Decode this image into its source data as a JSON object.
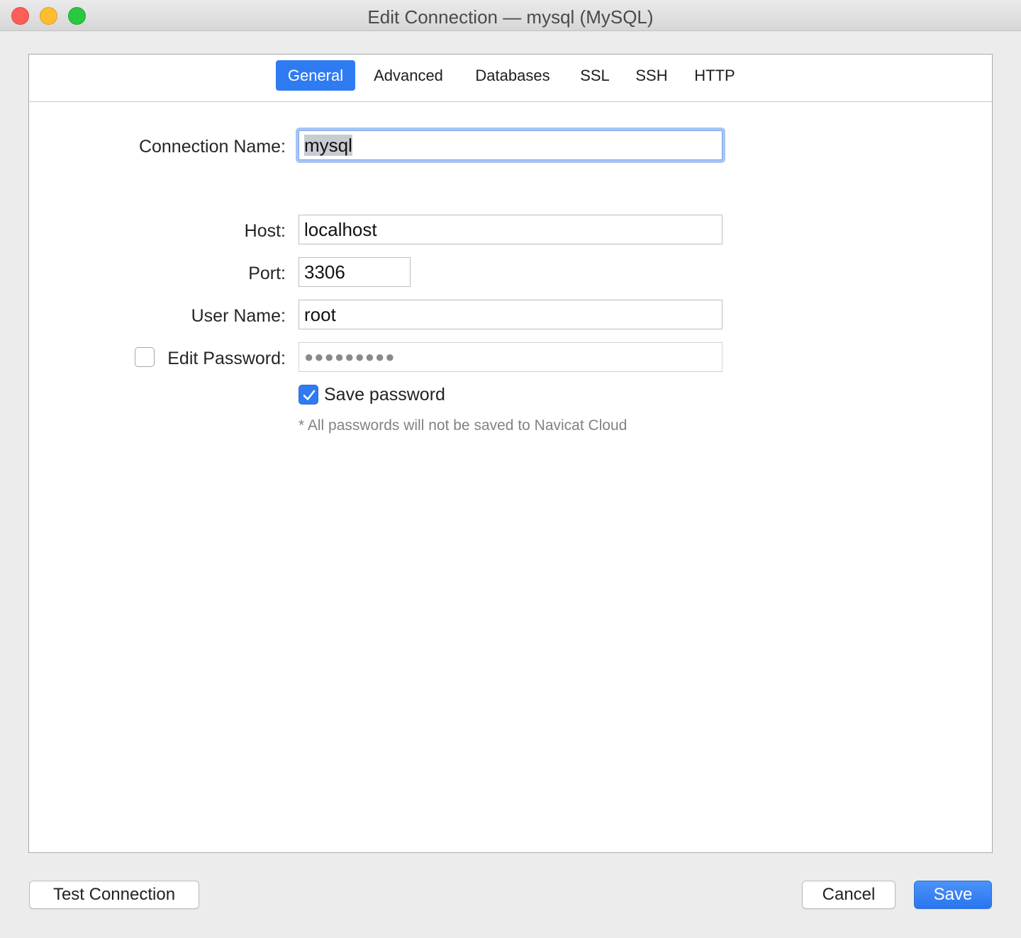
{
  "window": {
    "title": "Edit Connection — mysql (MySQL)"
  },
  "tabs": [
    {
      "label": "General",
      "active": true
    },
    {
      "label": "Advanced",
      "active": false
    },
    {
      "label": "Databases",
      "active": false
    },
    {
      "label": "SSL",
      "active": false
    },
    {
      "label": "SSH",
      "active": false
    },
    {
      "label": "HTTP",
      "active": false
    }
  ],
  "form": {
    "connection_name": {
      "label": "Connection Name:",
      "value": "mysql"
    },
    "host": {
      "label": "Host:",
      "value": "localhost"
    },
    "port": {
      "label": "Port:",
      "value": "3306"
    },
    "user_name": {
      "label": "User Name:",
      "value": "root"
    },
    "edit_password": {
      "label": "Edit Password:",
      "checked": false,
      "value": "●●●●●●●●●"
    },
    "save_password": {
      "label": "Save password",
      "checked": true
    },
    "note": "* All passwords will not be saved to Navicat Cloud"
  },
  "buttons": {
    "test_connection": "Test Connection",
    "cancel": "Cancel",
    "save": "Save"
  },
  "colors": {
    "accent": "#2f7bf2",
    "focus_ring": "#a8c5f2"
  }
}
